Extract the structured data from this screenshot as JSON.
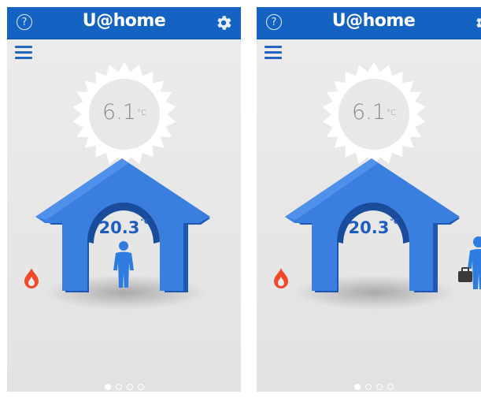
{
  "screens": [
    {
      "app_title": "U@home",
      "help_symbol": "?",
      "outdoor_temp": "6.1",
      "outdoor_unit": "°C",
      "indoor_temp": "20.3",
      "indoor_unit": "°C",
      "presence_state": "at home",
      "person_icon": "person-icon",
      "active_page": 1,
      "page_count": 4
    },
    {
      "app_title": "U@home",
      "help_symbol": "?",
      "outdoor_temp": "6.1",
      "outdoor_unit": "°C",
      "indoor_temp": "20.3",
      "indoor_unit": "°C",
      "presence_state": "away",
      "person_icon": "person-with-briefcase-icon",
      "active_page": 1,
      "page_count": 4
    }
  ],
  "colors": {
    "header_blue": "#1463c2",
    "house_blue": "#2a6fd1",
    "flame_red": "#f04a2b",
    "sun_white": "#ffffff"
  }
}
